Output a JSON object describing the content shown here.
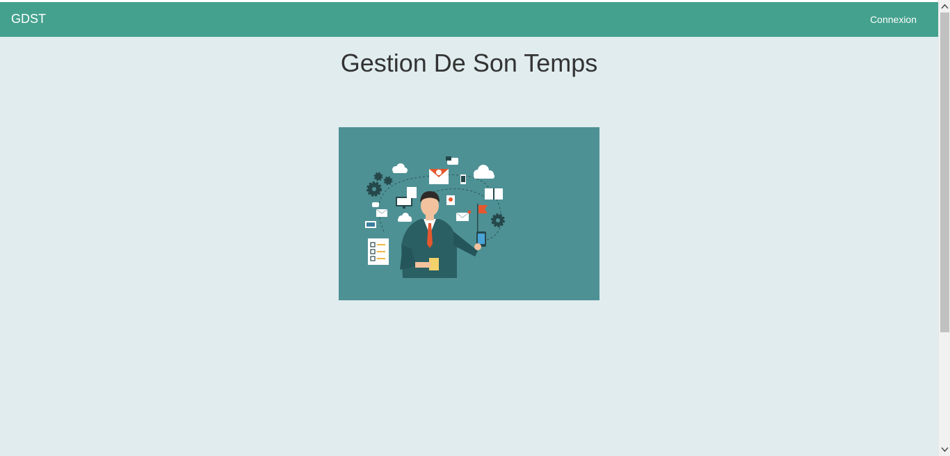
{
  "navbar": {
    "brand": "GDST",
    "login_label": "Connexion",
    "background": "#44a18e"
  },
  "main": {
    "title": "Gestion De Son Temps",
    "hero_image": "businessman multitasking illustration"
  },
  "colors": {
    "page_background": "#e0ecee",
    "hero_background": "#4e9195",
    "suit": "#2a5f63",
    "tie": "#e5572e"
  },
  "scrollbar": {
    "up_icon": "chevron-up-icon",
    "down_icon": "chevron-down-icon"
  }
}
